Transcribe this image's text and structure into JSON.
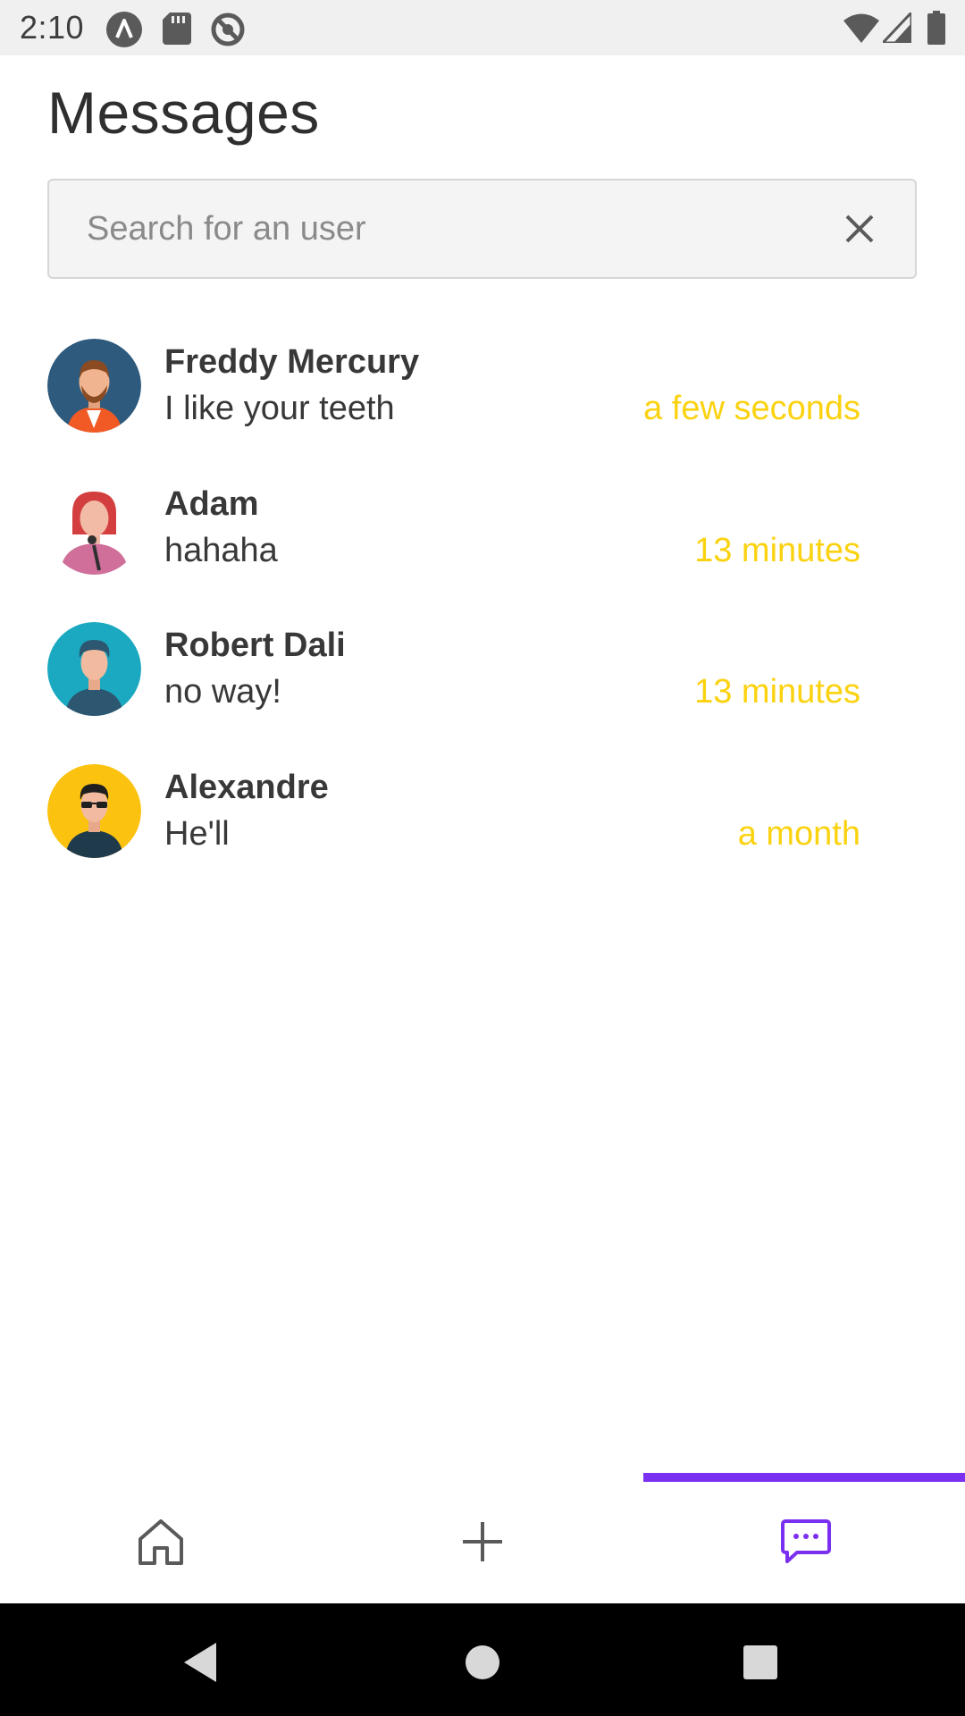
{
  "status_bar": {
    "time": "2:10",
    "icons": [
      "assistant-icon",
      "sd-card-icon",
      "sync-disabled-icon",
      "wifi-icon",
      "signal-icon",
      "battery-icon"
    ]
  },
  "header": {
    "title": "Messages"
  },
  "search": {
    "placeholder": "Search for an user",
    "value": ""
  },
  "conversations": [
    {
      "name": "Freddy Mercury",
      "preview": "I like your teeth",
      "time": "a few seconds",
      "avatar": "bearded-man-avatar",
      "avatar_bg": "#2e5a7d"
    },
    {
      "name": "Adam",
      "preview": "hahaha",
      "time": "13 minutes",
      "avatar": "singer-woman-avatar",
      "avatar_bg": "#ffffff"
    },
    {
      "name": "Robert Dali",
      "preview": "no way!",
      "time": "13 minutes",
      "avatar": "young-man-avatar",
      "avatar_bg": "#1aa9c0"
    },
    {
      "name": "Alexandre",
      "preview": "He'll",
      "time": "a month",
      "avatar": "sunglasses-man-avatar",
      "avatar_bg": "#fbc20f"
    }
  ],
  "tabs": [
    {
      "id": "home",
      "icon": "home-icon",
      "active": false
    },
    {
      "id": "new",
      "icon": "plus-icon",
      "active": false
    },
    {
      "id": "messages",
      "icon": "message-icon",
      "active": true
    }
  ],
  "colors": {
    "accent": "#7b2ff0",
    "timestamp": "#fbd20f",
    "text": "#383838",
    "status_bar_bg": "#f1f0f1"
  },
  "nav_bar": {
    "buttons": [
      "back-icon",
      "home-circle-icon",
      "recents-icon"
    ]
  }
}
